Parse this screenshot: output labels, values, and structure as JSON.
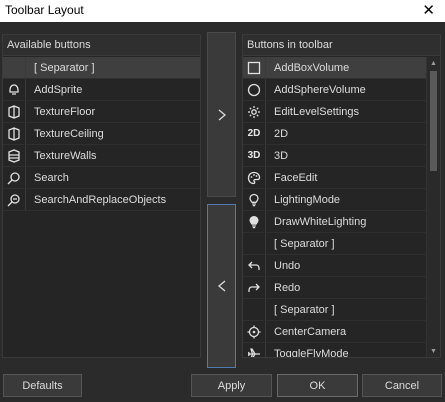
{
  "window": {
    "title": "Toolbar Layout",
    "close_glyph": "✕"
  },
  "available": {
    "header": "Available buttons",
    "items": [
      {
        "label": "[ Separator ]",
        "icon": "blank-icon",
        "selected": true
      },
      {
        "label": "AddSprite",
        "icon": "sprite-icon"
      },
      {
        "label": "TextureFloor",
        "icon": "texture-floor-icon"
      },
      {
        "label": "TextureCeiling",
        "icon": "texture-ceiling-icon"
      },
      {
        "label": "TextureWalls",
        "icon": "texture-walls-icon"
      },
      {
        "label": "Search",
        "icon": "search-icon"
      },
      {
        "label": "SearchAndReplaceObjects",
        "icon": "search-replace-icon"
      }
    ]
  },
  "toolbar": {
    "header": "Buttons in toolbar",
    "items": [
      {
        "label": "AddBoxVolume",
        "icon": "box-icon",
        "selected": true
      },
      {
        "label": "AddSphereVolume",
        "icon": "sphere-icon"
      },
      {
        "label": "EditLevelSettings",
        "icon": "gear-icon"
      },
      {
        "label": "2D",
        "icon": "2d-icon",
        "icon_text": "2D"
      },
      {
        "label": "3D",
        "icon": "3d-icon",
        "icon_text": "3D"
      },
      {
        "label": "FaceEdit",
        "icon": "palette-icon"
      },
      {
        "label": "LightingMode",
        "icon": "bulb-icon"
      },
      {
        "label": "DrawWhiteLighting",
        "icon": "bulb-white-icon"
      },
      {
        "label": "[ Separator ]",
        "icon": "blank-icon"
      },
      {
        "label": "Undo",
        "icon": "undo-icon"
      },
      {
        "label": "Redo",
        "icon": "redo-icon"
      },
      {
        "label": "[ Separator ]",
        "icon": "blank-icon"
      },
      {
        "label": "CenterCamera",
        "icon": "crosshair-icon"
      },
      {
        "label": "ToggleFlyMode",
        "icon": "plane-icon"
      }
    ]
  },
  "buttons": {
    "defaults": "Defaults",
    "apply": "Apply",
    "ok": "OK",
    "cancel": "Cancel"
  },
  "colors": {
    "background": "#2b2b2b",
    "panel": "#252525",
    "selected_row": "#3f3f3f",
    "focus_border": "#4e7bb3"
  }
}
